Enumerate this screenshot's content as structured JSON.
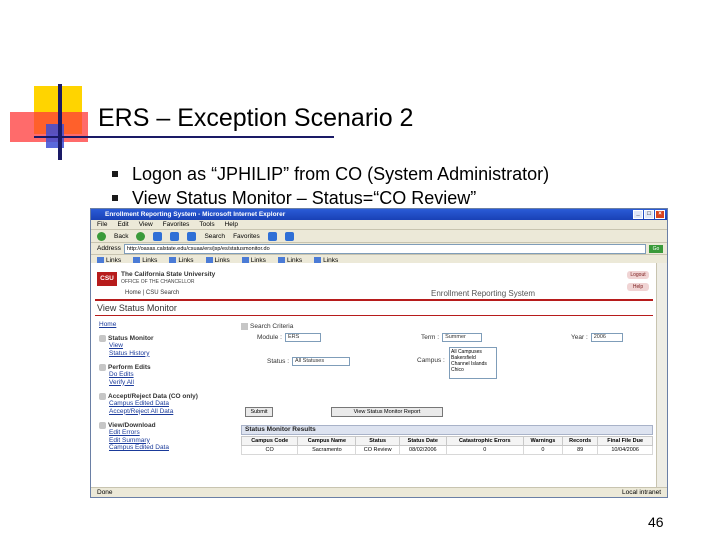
{
  "slide": {
    "title": "ERS – Exception Scenario 2",
    "bullets": [
      "Logon as “JPHILIP” from CO (System Administrator)",
      "View Status Monitor – Status=“CO Review”"
    ],
    "page_number": "46"
  },
  "browser": {
    "window_title": "Enrollment Reporting System - Microsoft Internet Explorer",
    "menu": [
      "File",
      "Edit",
      "View",
      "Favorites",
      "Tools",
      "Help"
    ],
    "toolbar": [
      "Back",
      "Search",
      "Favorites"
    ],
    "address_label": "Address",
    "address": "http://oasas.calstate.edu/csuaa/ers/jsp/es/statusmonitor.do",
    "go_label": "Go",
    "links": [
      "Links",
      "Links",
      "Links",
      "Links",
      "Links",
      "Links",
      "Links"
    ],
    "status_left": "Done",
    "status_right": "Local intranet"
  },
  "site": {
    "logo": "CSU",
    "university": "The California State University",
    "office": "OFFICE OF THE CHANCELLOR",
    "nav": "Home | CSU Search",
    "system_name": "Enrollment Reporting System",
    "header_icons": [
      "Logout",
      "Help"
    ],
    "page_heading": "View Status Monitor"
  },
  "sidebar": {
    "home": "Home",
    "sections": [
      {
        "title": "Status Monitor",
        "items": [
          "View",
          "Status History"
        ]
      },
      {
        "title": "Perform Edits",
        "items": [
          "Do Edits",
          "Verify All"
        ]
      },
      {
        "title": "Accept/Reject Data (CO only)",
        "items": [
          "Campus Edited Data",
          "Accept/Reject All Data"
        ]
      },
      {
        "title": "View/Download",
        "items": [
          "Edit Errors",
          "Edit Summary",
          "Campus Edited Data"
        ]
      }
    ]
  },
  "criteria": {
    "label": "Search Criteria",
    "module_label": "Module :",
    "module_value": "ERS",
    "term_label": "Term :",
    "term_value": "Summer",
    "year_label": "Year :",
    "year_value": "2006",
    "status_label": "Status :",
    "status_value": "All Statuses",
    "campus_label": "Campus :",
    "campus_options": [
      "All Campuses",
      "Bakersfield",
      "Channel Islands",
      "Chico"
    ],
    "submit_label": "Submit",
    "report_label": "View Status Monitor Report"
  },
  "results": {
    "label": "Status Monitor Results",
    "columns": [
      "Campus Code",
      "Campus Name",
      "Status",
      "Status Date",
      "Catastrophic Errors",
      "Warnings",
      "Records",
      "Final File Due"
    ],
    "rows": [
      [
        "CO",
        "Sacramento",
        "CO Review",
        "08/02/2006",
        "0",
        "0",
        "89",
        "10/04/2006"
      ]
    ]
  }
}
